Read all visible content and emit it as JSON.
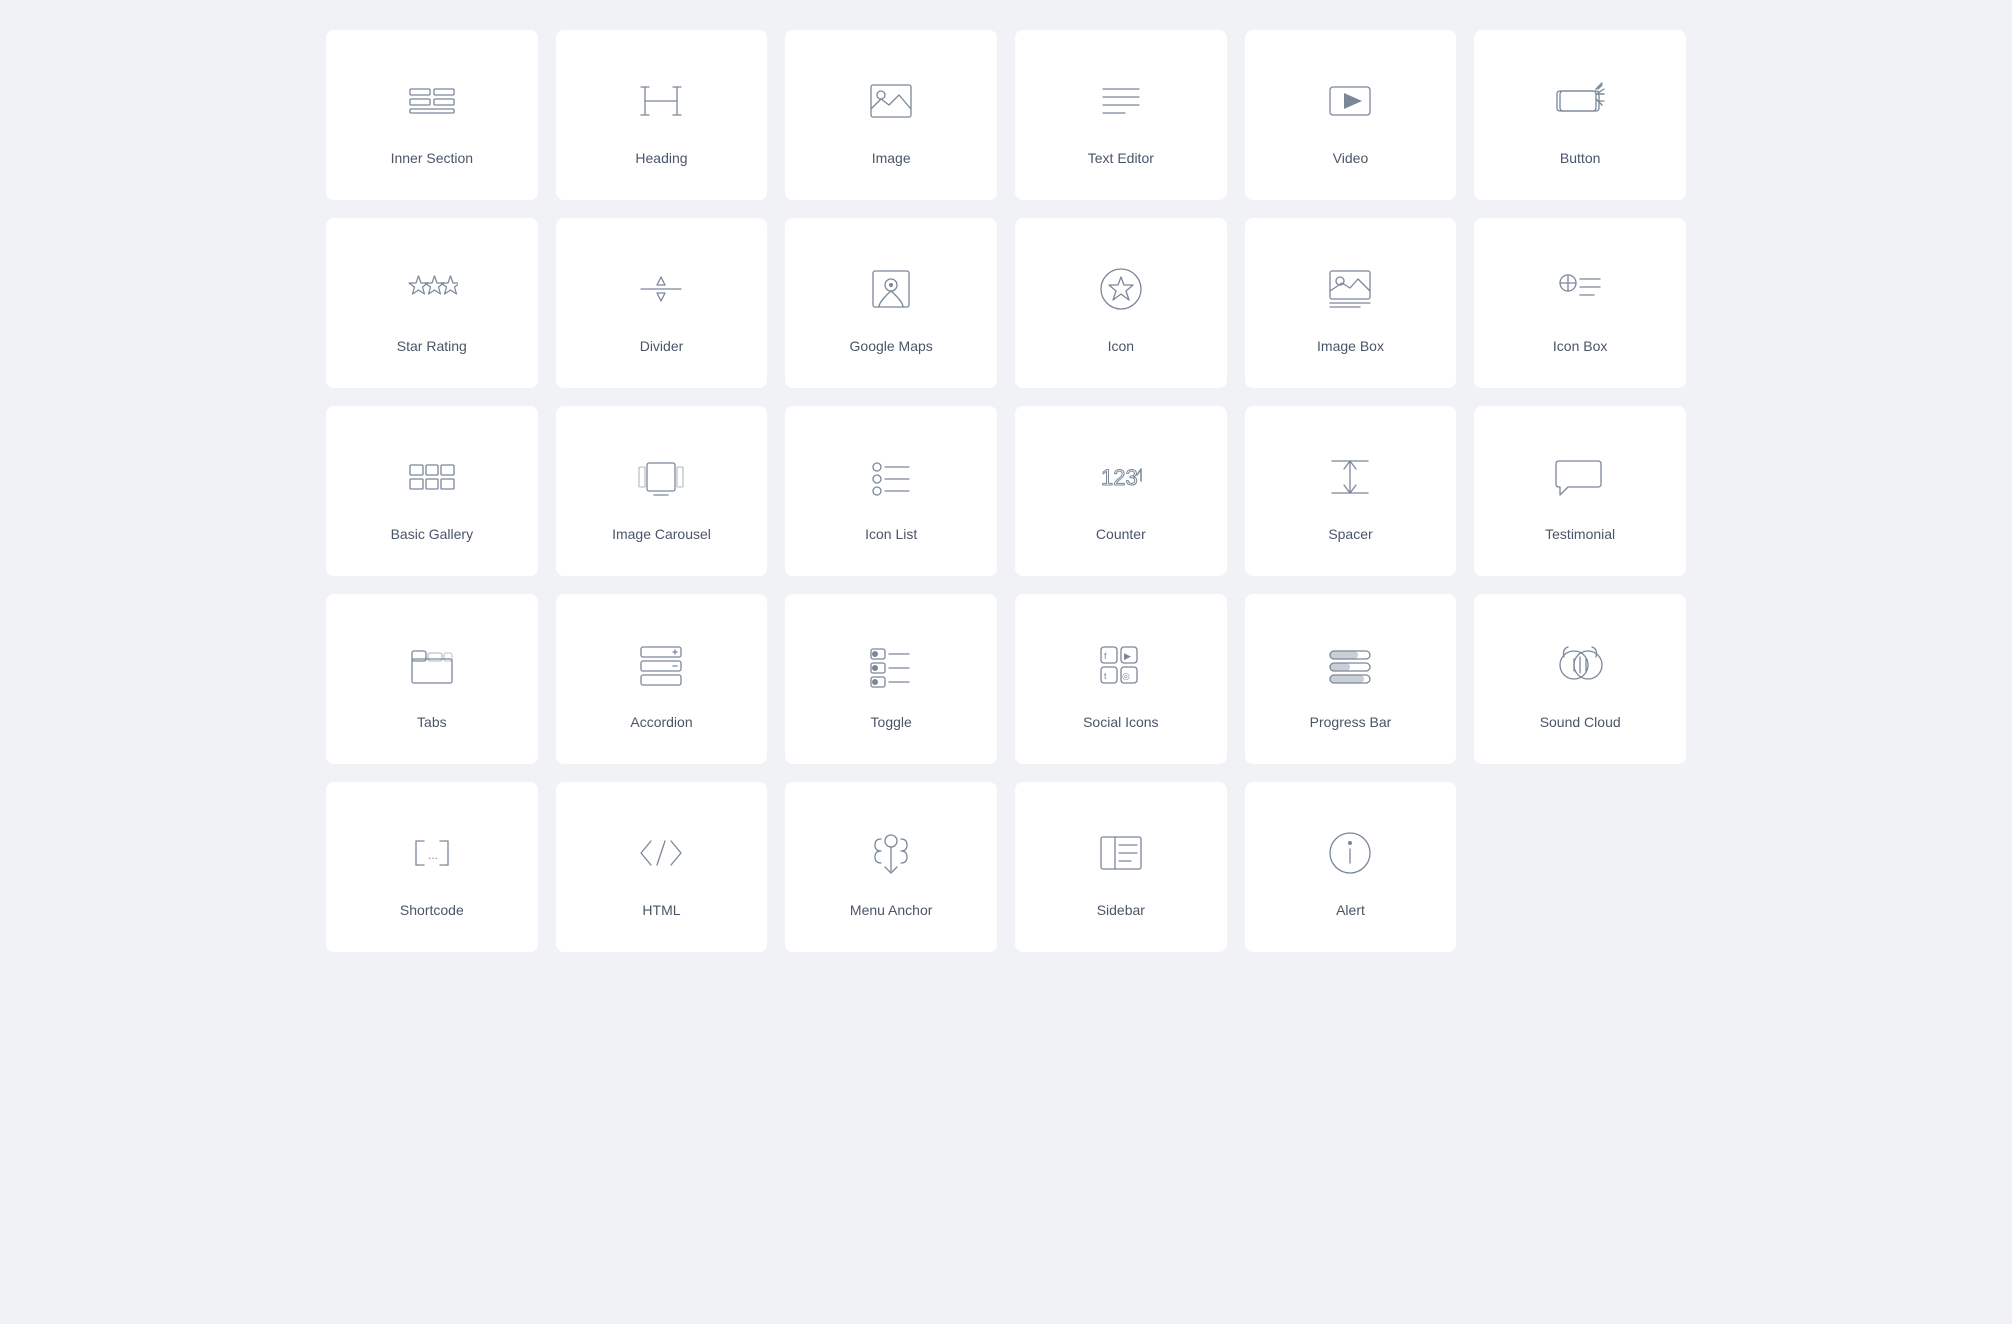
{
  "widgets": [
    {
      "id": "inner-section",
      "label": "Inner Section",
      "icon": "inner-section"
    },
    {
      "id": "heading",
      "label": "Heading",
      "icon": "heading"
    },
    {
      "id": "image",
      "label": "Image",
      "icon": "image"
    },
    {
      "id": "text-editor",
      "label": "Text Editor",
      "icon": "text-editor"
    },
    {
      "id": "video",
      "label": "Video",
      "icon": "video"
    },
    {
      "id": "button",
      "label": "Button",
      "icon": "button"
    },
    {
      "id": "star-rating",
      "label": "Star Rating",
      "icon": "star-rating"
    },
    {
      "id": "divider",
      "label": "Divider",
      "icon": "divider"
    },
    {
      "id": "google-maps",
      "label": "Google Maps",
      "icon": "google-maps"
    },
    {
      "id": "icon",
      "label": "Icon",
      "icon": "icon"
    },
    {
      "id": "image-box",
      "label": "Image Box",
      "icon": "image-box"
    },
    {
      "id": "icon-box",
      "label": "Icon Box",
      "icon": "icon-box"
    },
    {
      "id": "basic-gallery",
      "label": "Basic Gallery",
      "icon": "basic-gallery"
    },
    {
      "id": "image-carousel",
      "label": "Image Carousel",
      "icon": "image-carousel"
    },
    {
      "id": "icon-list",
      "label": "Icon List",
      "icon": "icon-list"
    },
    {
      "id": "counter",
      "label": "Counter",
      "icon": "counter"
    },
    {
      "id": "spacer",
      "label": "Spacer",
      "icon": "spacer"
    },
    {
      "id": "testimonial",
      "label": "Testimonial",
      "icon": "testimonial"
    },
    {
      "id": "tabs",
      "label": "Tabs",
      "icon": "tabs"
    },
    {
      "id": "accordion",
      "label": "Accordion",
      "icon": "accordion"
    },
    {
      "id": "toggle",
      "label": "Toggle",
      "icon": "toggle"
    },
    {
      "id": "social-icons",
      "label": "Social Icons",
      "icon": "social-icons"
    },
    {
      "id": "progress-bar",
      "label": "Progress Bar",
      "icon": "progress-bar"
    },
    {
      "id": "sound-cloud",
      "label": "Sound Cloud",
      "icon": "sound-cloud"
    },
    {
      "id": "shortcode",
      "label": "Shortcode",
      "icon": "shortcode"
    },
    {
      "id": "html",
      "label": "HTML",
      "icon": "html"
    },
    {
      "id": "menu-anchor",
      "label": "Menu Anchor",
      "icon": "menu-anchor"
    },
    {
      "id": "sidebar",
      "label": "Sidebar",
      "icon": "sidebar"
    },
    {
      "id": "alert",
      "label": "Alert",
      "icon": "alert"
    }
  ]
}
